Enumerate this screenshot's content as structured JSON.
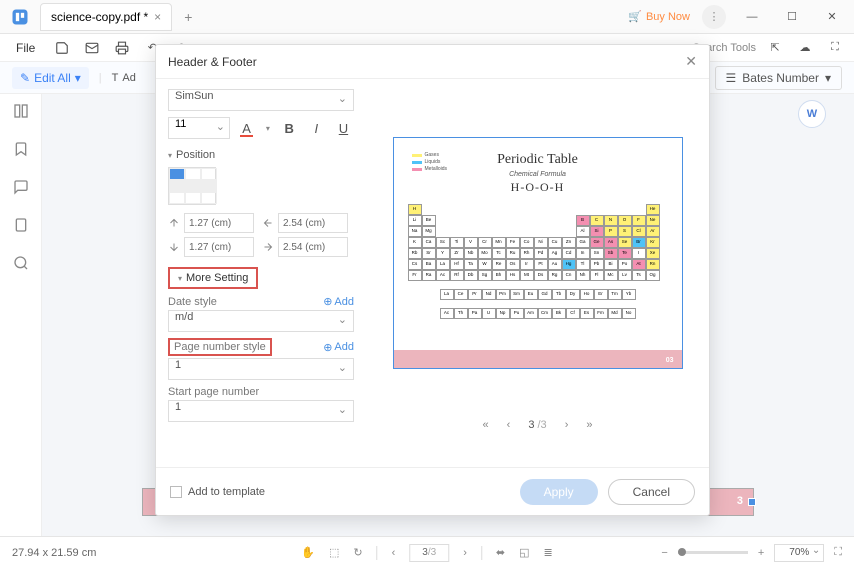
{
  "titlebar": {
    "tab_name": "science-copy.pdf *",
    "buy_now": "Buy Now"
  },
  "menubar": {
    "file": "File",
    "search_tools": "Search Tools"
  },
  "toolbar": {
    "edit_all": "Edit All",
    "add": "Ad",
    "bates_number": "Bates Number"
  },
  "modal": {
    "title": "Header & Footer",
    "font": "SimSun",
    "font_size": "11",
    "position_label": "Position",
    "margins": {
      "top": "1.27 (cm)",
      "left": "2.54 (cm)",
      "bottom": "1.27 (cm)",
      "right": "2.54 (cm)"
    },
    "more_setting": "More Setting",
    "date_style_label": "Date style",
    "date_style_value": "m/d",
    "page_number_style_label": "Page number style",
    "page_number_style_value": "1",
    "start_page_label": "Start page number",
    "start_page_value": "1",
    "add_link": "Add",
    "add_to_template": "Add to template",
    "apply": "Apply",
    "cancel": "Cancel",
    "pager": {
      "current": "3",
      "total": "/3"
    }
  },
  "preview": {
    "title": "Periodic Table",
    "subtitle": "Chemical Formula",
    "formula": "H-O-O-H",
    "page_num": "03",
    "legend": [
      "Gases",
      "Liquids",
      "Metalloids"
    ]
  },
  "canvas": {
    "pink_num": "3"
  },
  "statusbar": {
    "dims": "27.94 x 21.59 cm",
    "page_current": "3",
    "page_total": "/3",
    "zoom": "70%"
  }
}
